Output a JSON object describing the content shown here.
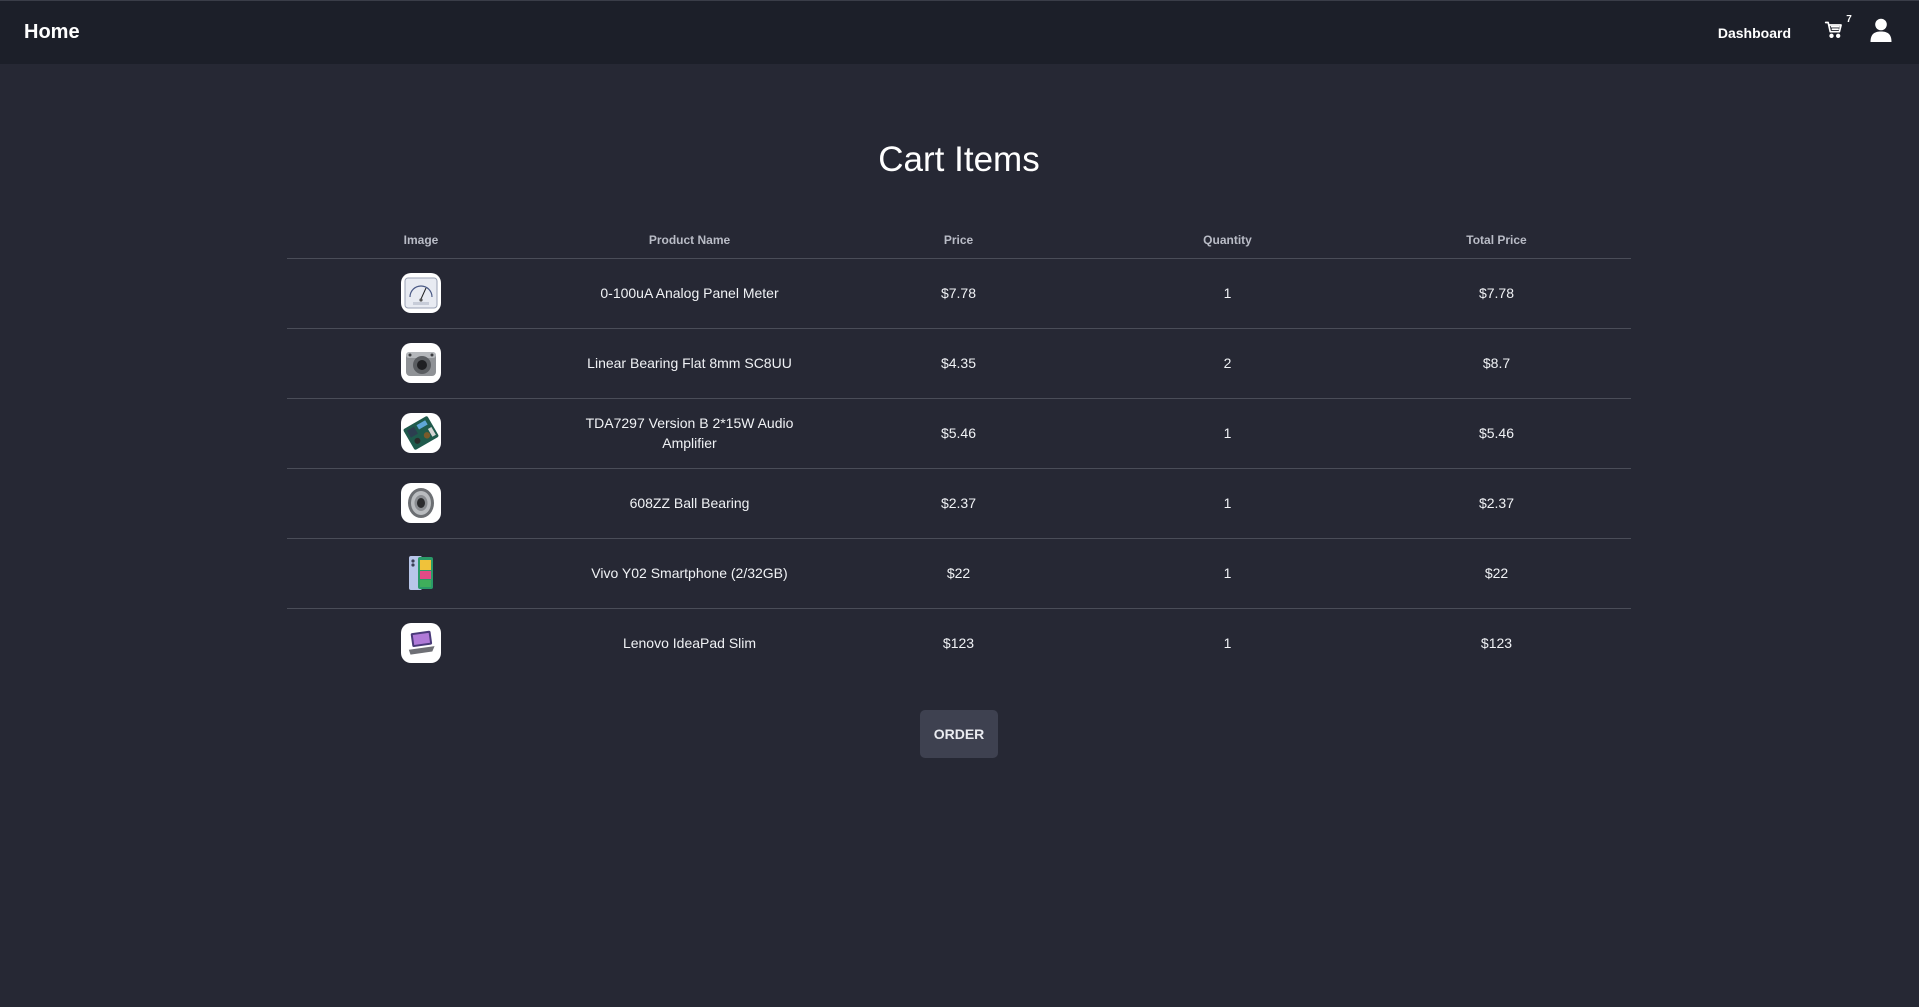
{
  "header": {
    "brand": "Home",
    "dashboard_label": "Dashboard",
    "cart_count": "7",
    "cart_icon": "cart-icon",
    "user_icon": "user-icon"
  },
  "page": {
    "title": "Cart Items"
  },
  "table": {
    "columns": [
      "Image",
      "Product Name",
      "Price",
      "Quantity",
      "Total Price"
    ],
    "rows": [
      {
        "name": "0-100uA Analog Panel Meter",
        "price": "$7.78",
        "quantity": "1",
        "total": "$7.78",
        "image_icon": "panel-meter-image"
      },
      {
        "name": "Linear Bearing Flat 8mm SC8UU",
        "price": "$4.35",
        "quantity": "2",
        "total": "$8.7",
        "image_icon": "linear-bearing-image"
      },
      {
        "name": "TDA7297 Version B 2*15W Audio Amplifier",
        "price": "$5.46",
        "quantity": "1",
        "total": "$5.46",
        "image_icon": "amplifier-board-image"
      },
      {
        "name": "608ZZ Ball Bearing",
        "price": "$2.37",
        "quantity": "1",
        "total": "$2.37",
        "image_icon": "ball-bearing-image"
      },
      {
        "name": "Vivo Y02 Smartphone (2/32GB)",
        "price": "$22",
        "quantity": "1",
        "total": "$22",
        "image_icon": "smartphone-image"
      },
      {
        "name": "Lenovo IdeaPad Slim",
        "price": "$123",
        "quantity": "1",
        "total": "$123",
        "image_icon": "laptop-image"
      }
    ]
  },
  "actions": {
    "order_label": "ORDER"
  },
  "colors": {
    "background": "#262834",
    "header_background": "#1c1f29",
    "button_background": "#3e4150"
  }
}
